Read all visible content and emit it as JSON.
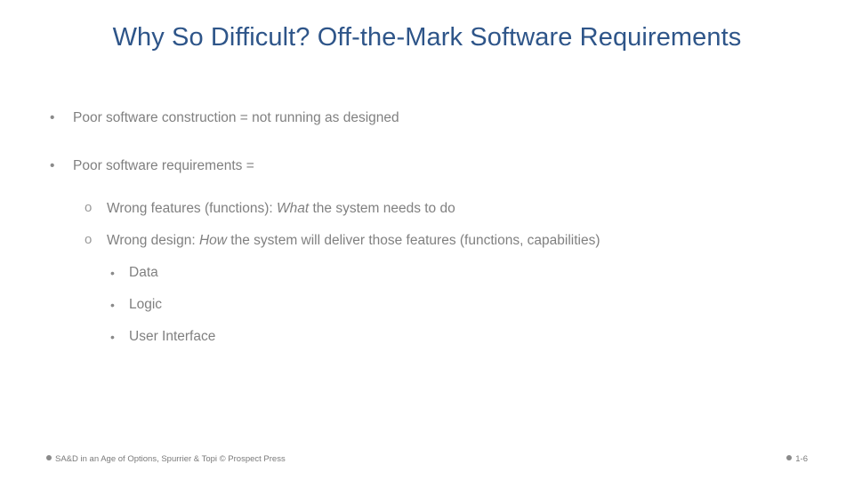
{
  "slide": {
    "title": "Why So Difficult? Off-the-Mark Software Requirements",
    "title_color": "#2e5589",
    "body_color": "#808080",
    "background_color": "#ffffff"
  },
  "outline": {
    "level1": [
      {
        "marker": "•",
        "text": "Poor software construction = not running as designed"
      },
      {
        "marker": "•",
        "text": "Poor software requirements ="
      }
    ],
    "level2": [
      {
        "marker": "o",
        "text_before": "Wrong features (functions): ",
        "emphasis": "What",
        "text_after": " the system needs to do"
      },
      {
        "marker": "o",
        "text_before": "Wrong design: ",
        "emphasis": "How",
        "text_after": " the system will deliver those features (functions, capabilities)"
      }
    ],
    "level3": [
      {
        "marker": "•",
        "text": "Data"
      },
      {
        "marker": "•",
        "text": "Logic"
      },
      {
        "marker": "•",
        "text": "User Interface"
      }
    ]
  },
  "footer": {
    "left_text": "SA&D in an Age of Options, Spurrier & Topi © Prospect Press",
    "right_text": "1-6",
    "dot_icon": "filled-circle"
  }
}
